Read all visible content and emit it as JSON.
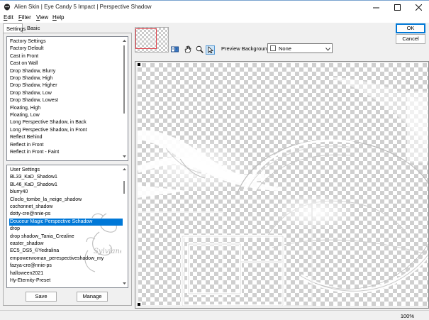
{
  "window": {
    "title": "Alien Skin | Eye Candy 5 Impact | Perspective Shadow",
    "controls": [
      "minimize-icon",
      "maximize-icon",
      "close-icon"
    ]
  },
  "menu": {
    "edit": {
      "underlined": "E",
      "rest": "dit"
    },
    "filter": {
      "underlined": "F",
      "rest": "ilter"
    },
    "view": {
      "underlined": "V",
      "rest": "iew"
    },
    "help": {
      "underlined": "H",
      "rest": "elp"
    }
  },
  "tabs": [
    {
      "label": "Settings",
      "active": true
    },
    {
      "label": "Basic",
      "active": false
    }
  ],
  "factory_settings": {
    "items": [
      "Factory Settings",
      "Factory Default",
      "Cast in Front",
      "Cast on Wall",
      "Drop Shadow, Blurry",
      "Drop Shadow, High",
      "Drop Shadow, Higher",
      "Drop Shadow, Low",
      "Drop Shadow, Lowest",
      "Floating, High",
      "Floating, Low",
      "Long Perspective Shadow, in Back",
      "Long Perspective Shadow, in Front",
      "Reflect Behind",
      "Reflect in Front",
      "Reflect in Front - Faint"
    ]
  },
  "user_settings": {
    "selected_index": 7,
    "items": [
      "User Settings",
      "BL33_KaD_Shadow1",
      "BL46_KaD_Shadow1",
      "blurry40",
      "Cloclo_tombe_la_neige_shadow",
      "cochonnet_shadow",
      "dotty-cre@nnie-ps",
      "Douceur Magic Perspective Schadow",
      "drop",
      "drop shadow_Tania_Crealine",
      "easter_shadow",
      "EC5_DS5_©Yedralina",
      "empowerwoman_perespectiveshadow_my",
      "fazya-cre@nnie-ps",
      "halloween2021",
      "Hy-Eternity-Preset"
    ]
  },
  "buttons": {
    "save": "Save",
    "manage": "Manage",
    "ok": "OK",
    "cancel": "Cancel"
  },
  "toolbar": {
    "tools": [
      "preview-toggle-icon",
      "hand-pan-icon",
      "zoom-icon",
      "select-arrow-icon"
    ],
    "active_tool": "select-arrow-icon"
  },
  "preview_background": {
    "label": "Preview Background:",
    "value": "None"
  },
  "status": {
    "zoom": "100%"
  },
  "watermark": "Sylviane"
}
